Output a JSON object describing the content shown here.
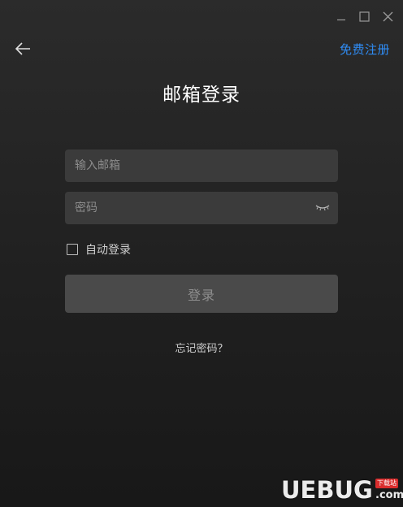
{
  "window": {
    "minimize_label": "",
    "maximize_label": "",
    "close_label": ""
  },
  "header": {
    "back_icon": "arrow-left-icon",
    "register_link": "免费注册"
  },
  "title": "邮箱登录",
  "form": {
    "email_placeholder": "输入邮箱",
    "email_value": "",
    "password_placeholder": "密码",
    "password_value": "",
    "password_toggle_icon": "eye-closed-icon",
    "auto_login_label": "自动登录",
    "auto_login_checked": false,
    "login_button": "登录",
    "forgot_password": "忘记密码？"
  },
  "watermark": {
    "main": "UEBUG",
    "tag": "下载站",
    "suffix": ".com"
  },
  "colors": {
    "link": "#2f8cf4",
    "background": "#222222",
    "input_bg": "#3b3b3b",
    "button_bg": "#4a4a4a"
  }
}
